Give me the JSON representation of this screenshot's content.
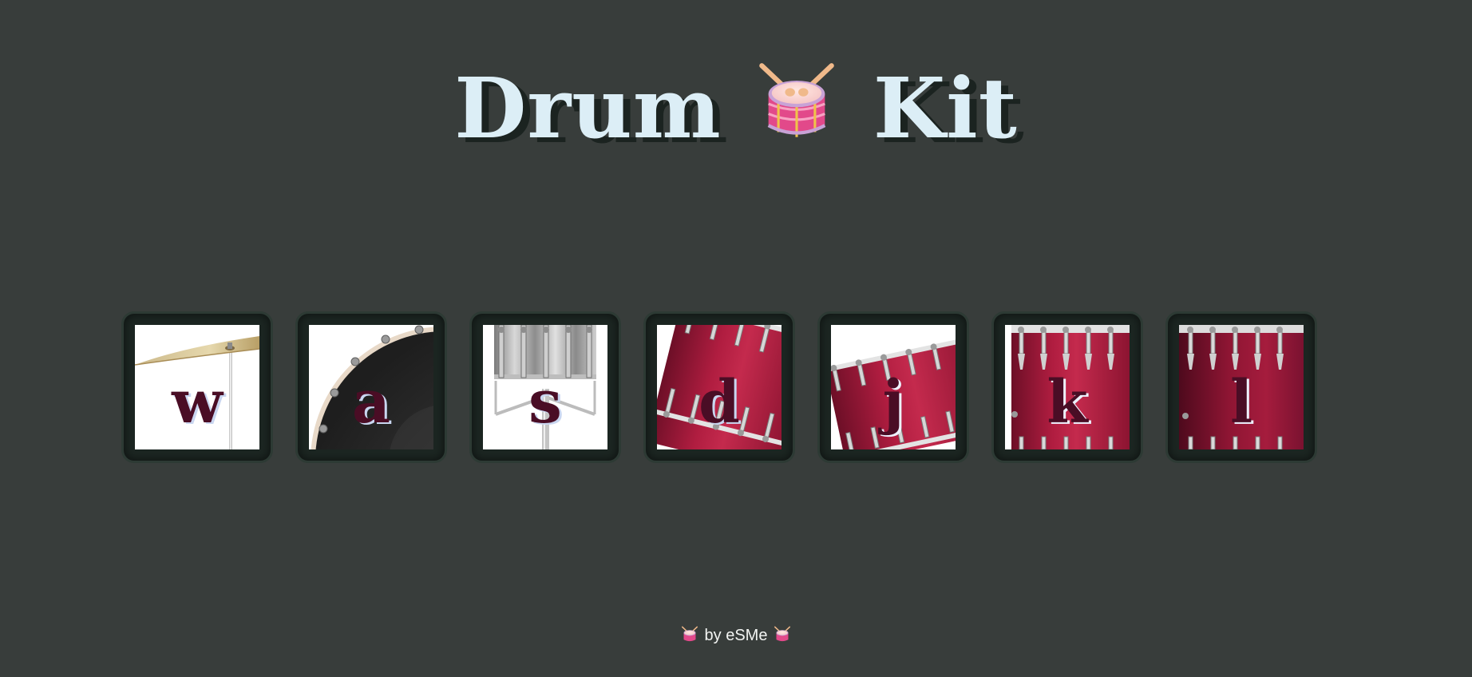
{
  "header": {
    "title_left": "Drum",
    "title_icon": "drum-emoji",
    "title_right": "Kit"
  },
  "keys": [
    {
      "letter": "w",
      "instrument": "crash-cymbal-icon"
    },
    {
      "letter": "a",
      "instrument": "bass-drum-icon"
    },
    {
      "letter": "s",
      "instrument": "snare-drum-icon"
    },
    {
      "letter": "d",
      "instrument": "tom-1-icon"
    },
    {
      "letter": "j",
      "instrument": "tom-2-icon"
    },
    {
      "letter": "k",
      "instrument": "tom-3-icon"
    },
    {
      "letter": "l",
      "instrument": "floor-tom-icon"
    }
  ],
  "footer": {
    "text": "by eSMe",
    "icon": "drum-emoji"
  },
  "colors": {
    "background": "#383d3b",
    "title_text": "#dceef6",
    "title_shadow": "#1b2320",
    "key_frame": "#1c2622",
    "letter": "#4a0d25",
    "drum_red": "#a81a3c"
  }
}
